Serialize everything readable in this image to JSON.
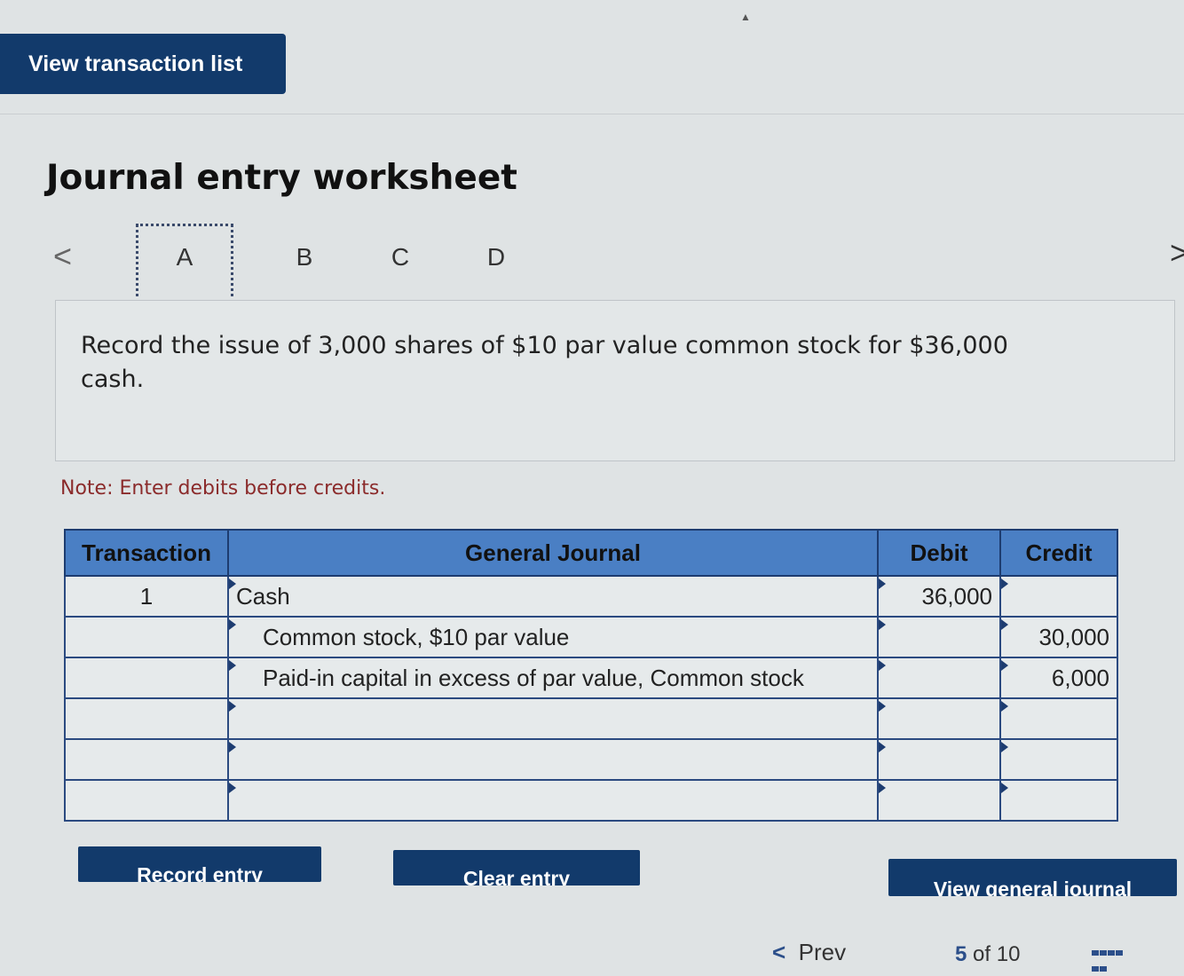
{
  "header": {
    "view_transaction_list": "View transaction list"
  },
  "page": {
    "title": "Journal entry worksheet"
  },
  "tabs": [
    "A",
    "B",
    "C",
    "D"
  ],
  "active_tab": "A",
  "description": "Record the issue of 3,000 shares of $10 par value common stock for $36,000 cash.",
  "note": "Note: Enter debits before credits.",
  "table": {
    "headers": {
      "transaction": "Transaction",
      "general_journal": "General Journal",
      "debit": "Debit",
      "credit": "Credit"
    },
    "rows": [
      {
        "transaction": "1",
        "account": "Cash",
        "debit": "36,000",
        "credit": ""
      },
      {
        "transaction": "",
        "account": "Common stock, $10 par value",
        "debit": "",
        "credit": "30,000"
      },
      {
        "transaction": "",
        "account": "Paid-in capital in excess of par value, Common stock",
        "debit": "",
        "credit": "6,000"
      },
      {
        "transaction": "",
        "account": "",
        "debit": "",
        "credit": ""
      },
      {
        "transaction": "",
        "account": "",
        "debit": "",
        "credit": ""
      },
      {
        "transaction": "",
        "account": "",
        "debit": "",
        "credit": ""
      }
    ]
  },
  "buttons": {
    "record_entry": "Record entry",
    "clear_entry": "Clear entry",
    "view_general_journal": "View general journal"
  },
  "footer": {
    "prev": "Prev",
    "page_current": "5",
    "page_sep": "of",
    "page_total": "10"
  },
  "colors": {
    "primary": "#123a6b",
    "header_blue": "#4a7fc4",
    "note_red": "#8b2b2b"
  },
  "icons": {
    "prev": "chevron-left-icon",
    "next": "chevron-right-icon",
    "grid": "grid-icon"
  }
}
